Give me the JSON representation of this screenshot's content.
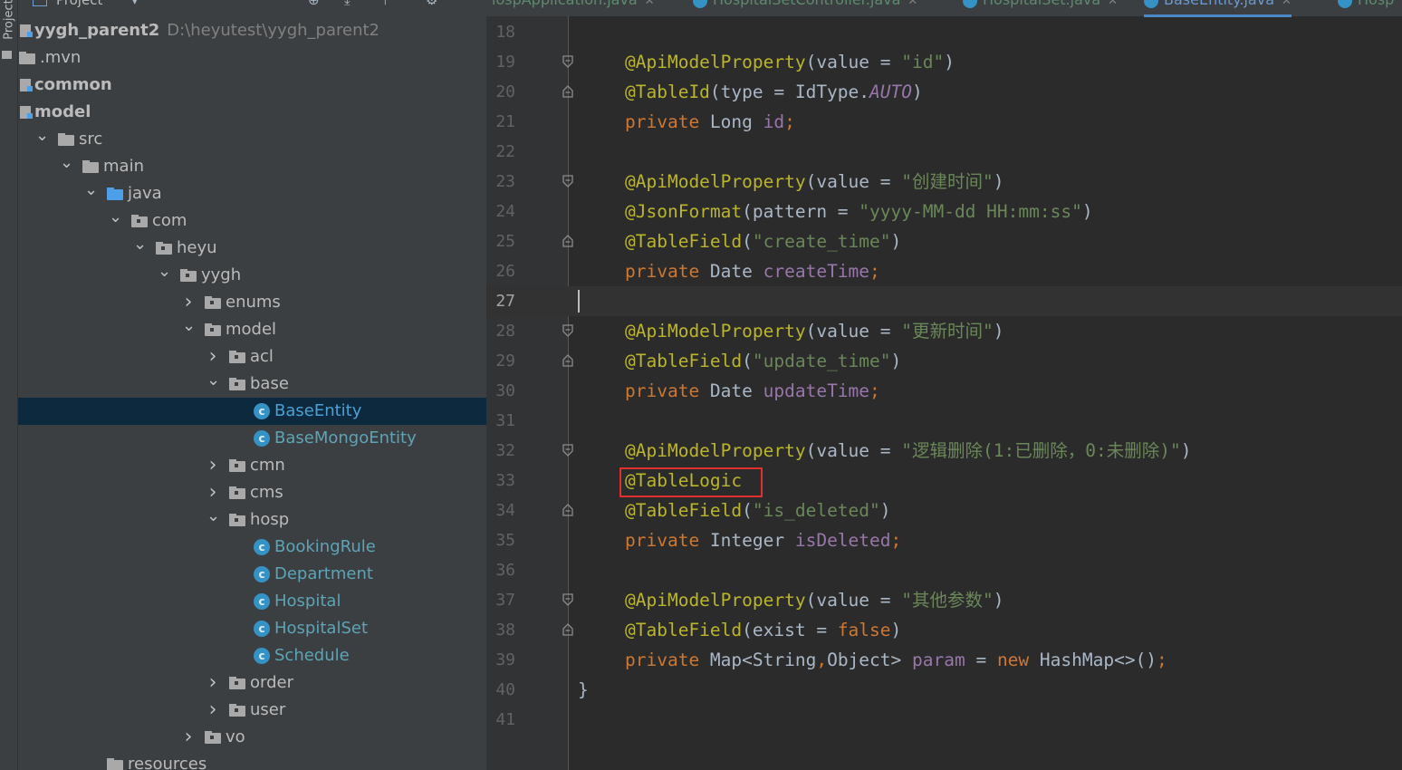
{
  "side_strip": {
    "label": "Project"
  },
  "project_panel": {
    "title": "Project",
    "tree": [
      {
        "label": "yygh_parent2",
        "path": "D:\\heyutest\\yygh_parent2",
        "indent": 0,
        "icon": "module",
        "bold": true,
        "arrow": "none"
      },
      {
        "label": ".mvn",
        "indent": 0,
        "icon": "folder",
        "arrow": "none"
      },
      {
        "label": "common",
        "indent": 0,
        "icon": "module",
        "bold": true,
        "arrow": "none"
      },
      {
        "label": "model",
        "indent": 0,
        "icon": "module",
        "bold": true,
        "arrow": "none"
      },
      {
        "label": "src",
        "indent": 1,
        "icon": "folder",
        "arrow": "down"
      },
      {
        "label": "main",
        "indent": 2,
        "icon": "folder",
        "arrow": "down"
      },
      {
        "label": "java",
        "indent": 3,
        "icon": "folder-blue",
        "arrow": "down"
      },
      {
        "label": "com",
        "indent": 4,
        "icon": "package",
        "arrow": "down"
      },
      {
        "label": "heyu",
        "indent": 5,
        "icon": "package",
        "arrow": "down"
      },
      {
        "label": "yygh",
        "indent": 6,
        "icon": "package",
        "arrow": "down"
      },
      {
        "label": "enums",
        "indent": 7,
        "icon": "package",
        "arrow": "right"
      },
      {
        "label": "model",
        "indent": 7,
        "icon": "package",
        "arrow": "down"
      },
      {
        "label": "acl",
        "indent": 8,
        "icon": "package",
        "arrow": "right"
      },
      {
        "label": "base",
        "indent": 8,
        "icon": "package",
        "arrow": "down"
      },
      {
        "label": "BaseEntity",
        "indent": 9,
        "icon": "class",
        "arrow": "none",
        "selected": true
      },
      {
        "label": "BaseMongoEntity",
        "indent": 9,
        "icon": "class",
        "arrow": "none"
      },
      {
        "label": "cmn",
        "indent": 8,
        "icon": "package",
        "arrow": "right"
      },
      {
        "label": "cms",
        "indent": 8,
        "icon": "package",
        "arrow": "right"
      },
      {
        "label": "hosp",
        "indent": 8,
        "icon": "package",
        "arrow": "down"
      },
      {
        "label": "BookingRule",
        "indent": 9,
        "icon": "class",
        "arrow": "none"
      },
      {
        "label": "Department",
        "indent": 9,
        "icon": "class",
        "arrow": "none"
      },
      {
        "label": "Hospital",
        "indent": 9,
        "icon": "class",
        "arrow": "none"
      },
      {
        "label": "HospitalSet",
        "indent": 9,
        "icon": "class",
        "arrow": "none"
      },
      {
        "label": "Schedule",
        "indent": 9,
        "icon": "class",
        "arrow": "none"
      },
      {
        "label": "order",
        "indent": 8,
        "icon": "package",
        "arrow": "right"
      },
      {
        "label": "user",
        "indent": 8,
        "icon": "package",
        "arrow": "right"
      },
      {
        "label": "vo",
        "indent": 7,
        "icon": "package",
        "arrow": "right"
      },
      {
        "label": "resources",
        "indent": 3,
        "icon": "folder",
        "arrow": "none"
      }
    ]
  },
  "editor_tabs": [
    {
      "label": "iospApplication.java",
      "active": false,
      "icon": false
    },
    {
      "label": "HospitalSetController.java",
      "active": false,
      "icon": true
    },
    {
      "label": "HospitalSet.java",
      "active": false,
      "icon": true
    },
    {
      "label": "BaseEntity.java",
      "active": true,
      "icon": true
    },
    {
      "label": "Hosp",
      "active": false,
      "icon": true
    }
  ],
  "current_line": 27,
  "highlighted_line": 33,
  "code_lines": [
    {
      "n": "18",
      "fold": "",
      "parts": []
    },
    {
      "n": "19",
      "fold": "open",
      "parts": [
        [
          "ann",
          "@ApiModelProperty"
        ],
        [
          "txt",
          "(value = "
        ],
        [
          "str",
          "\"id\""
        ],
        [
          "txt",
          ")"
        ]
      ]
    },
    {
      "n": "20",
      "fold": "close",
      "parts": [
        [
          "ann",
          "@TableId"
        ],
        [
          "txt",
          "(type = IdType."
        ],
        [
          "it",
          "AUTO"
        ],
        [
          "txt",
          ")"
        ]
      ]
    },
    {
      "n": "21",
      "fold": "",
      "parts": [
        [
          "kw",
          "private "
        ],
        [
          "txt",
          "Long "
        ],
        [
          "fld",
          "id"
        ],
        [
          "kw",
          ";"
        ]
      ]
    },
    {
      "n": "22",
      "fold": "",
      "parts": []
    },
    {
      "n": "23",
      "fold": "open",
      "parts": [
        [
          "ann",
          "@ApiModelProperty"
        ],
        [
          "txt",
          "(value = "
        ],
        [
          "str",
          "\"创建时间\""
        ],
        [
          "txt",
          ")"
        ]
      ]
    },
    {
      "n": "24",
      "fold": "",
      "parts": [
        [
          "ann",
          "@JsonFormat"
        ],
        [
          "txt",
          "(pattern = "
        ],
        [
          "str",
          "\"yyyy-MM-dd HH:mm:ss\""
        ],
        [
          "txt",
          ")"
        ]
      ]
    },
    {
      "n": "25",
      "fold": "close",
      "parts": [
        [
          "ann",
          "@TableField"
        ],
        [
          "txt",
          "("
        ],
        [
          "str",
          "\"create_time\""
        ],
        [
          "txt",
          ")"
        ]
      ]
    },
    {
      "n": "26",
      "fold": "",
      "parts": [
        [
          "kw",
          "private "
        ],
        [
          "txt",
          "Date "
        ],
        [
          "fld",
          "createTime"
        ],
        [
          "kw",
          ";"
        ]
      ]
    },
    {
      "n": "27",
      "fold": "",
      "parts": []
    },
    {
      "n": "28",
      "fold": "open",
      "parts": [
        [
          "ann",
          "@ApiModelProperty"
        ],
        [
          "txt",
          "(value = "
        ],
        [
          "str",
          "\"更新时间\""
        ],
        [
          "txt",
          ")"
        ]
      ]
    },
    {
      "n": "29",
      "fold": "close",
      "parts": [
        [
          "ann",
          "@TableField"
        ],
        [
          "txt",
          "("
        ],
        [
          "str",
          "\"update_time\""
        ],
        [
          "txt",
          ")"
        ]
      ]
    },
    {
      "n": "30",
      "fold": "",
      "parts": [
        [
          "kw",
          "private "
        ],
        [
          "txt",
          "Date "
        ],
        [
          "fld",
          "updateTime"
        ],
        [
          "kw",
          ";"
        ]
      ]
    },
    {
      "n": "31",
      "fold": "",
      "parts": []
    },
    {
      "n": "32",
      "fold": "open",
      "parts": [
        [
          "ann",
          "@ApiModelProperty"
        ],
        [
          "txt",
          "(value = "
        ],
        [
          "str",
          "\"逻辑删除(1:已删除，0:未删除)\""
        ],
        [
          "txt",
          ")"
        ]
      ]
    },
    {
      "n": "33",
      "fold": "",
      "parts": [
        [
          "ann",
          "@TableLogic"
        ]
      ]
    },
    {
      "n": "34",
      "fold": "close",
      "parts": [
        [
          "ann",
          "@TableField"
        ],
        [
          "txt",
          "("
        ],
        [
          "str",
          "\"is_deleted\""
        ],
        [
          "txt",
          ")"
        ]
      ]
    },
    {
      "n": "35",
      "fold": "",
      "parts": [
        [
          "kw",
          "private "
        ],
        [
          "txt",
          "Integer "
        ],
        [
          "fld",
          "isDeleted"
        ],
        [
          "kw",
          ";"
        ]
      ]
    },
    {
      "n": "36",
      "fold": "",
      "parts": []
    },
    {
      "n": "37",
      "fold": "open",
      "parts": [
        [
          "ann",
          "@ApiModelProperty"
        ],
        [
          "txt",
          "(value = "
        ],
        [
          "str",
          "\"其他参数\""
        ],
        [
          "txt",
          ")"
        ]
      ]
    },
    {
      "n": "38",
      "fold": "close",
      "parts": [
        [
          "ann",
          "@TableField"
        ],
        [
          "txt",
          "(exist = "
        ],
        [
          "kw",
          "false"
        ],
        [
          "txt",
          ")"
        ]
      ]
    },
    {
      "n": "39",
      "fold": "",
      "parts": [
        [
          "kw",
          "private "
        ],
        [
          "txt",
          "Map<String"
        ],
        [
          "kw",
          ","
        ],
        [
          "txt",
          "Object> "
        ],
        [
          "fld",
          "param"
        ],
        [
          "txt",
          " = "
        ],
        [
          "kw",
          "new "
        ],
        [
          "txt",
          "HashMap<>()"
        ],
        [
          "kw",
          ";"
        ]
      ]
    },
    {
      "n": "40",
      "fold": "",
      "parts": [
        [
          "txt",
          "}"
        ]
      ],
      "outdent": true
    },
    {
      "n": "41",
      "fold": "",
      "parts": []
    }
  ],
  "colors": {
    "annotation": "#bbb529",
    "string": "#6a8759",
    "keyword": "#cc7832",
    "field": "#9876aa",
    "text": "#a9b7c6",
    "highlight_box": "#e0312e"
  }
}
